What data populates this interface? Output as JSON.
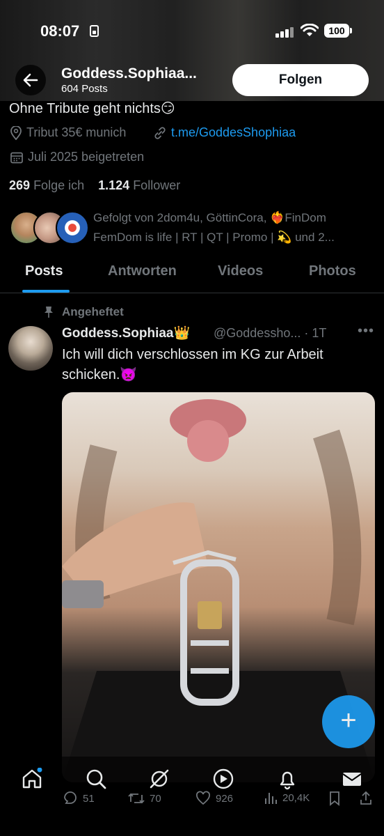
{
  "status_bar": {
    "time": "08:07",
    "battery": "100"
  },
  "header": {
    "title": "Goddess.Sophiaa...",
    "post_count": "604 Posts",
    "follow_label": "Folgen"
  },
  "profile": {
    "bio": "Ohne Tribute geht nichts😏",
    "location": "Tribut 35€ munich",
    "link": "t.me/GoddesShophiaa",
    "joined": "Juli 2025 beigetreten",
    "following_count": "269",
    "following_label": "Folge ich",
    "followers_count": "1.124",
    "followers_label": "Follower",
    "followed_by_line1": "Gefolgt von 2dom4u, GöttinCora, ❤️‍🔥FinDom",
    "followed_by_line2": "FemDom is life | RT | QT | Promo | 💫 und 2..."
  },
  "tabs": [
    {
      "label": "Posts",
      "active": true
    },
    {
      "label": "Antworten",
      "active": false
    },
    {
      "label": "Videos",
      "active": false
    },
    {
      "label": "Photos",
      "active": false
    }
  ],
  "tweet": {
    "pinned_label": "Angeheftet",
    "author": "Goddess.Sophiaa👑",
    "handle": "@Goddessho...",
    "time": "· 1T",
    "text": "Ich will dich verschlossen im KG zur Arbeit schicken.👿",
    "replies": "51",
    "retweets": "70",
    "likes": "926",
    "views": "20,4K"
  },
  "fab_label": "+",
  "colors": {
    "accent": "#1d9bf0",
    "muted": "#71767b",
    "background": "#000000"
  }
}
